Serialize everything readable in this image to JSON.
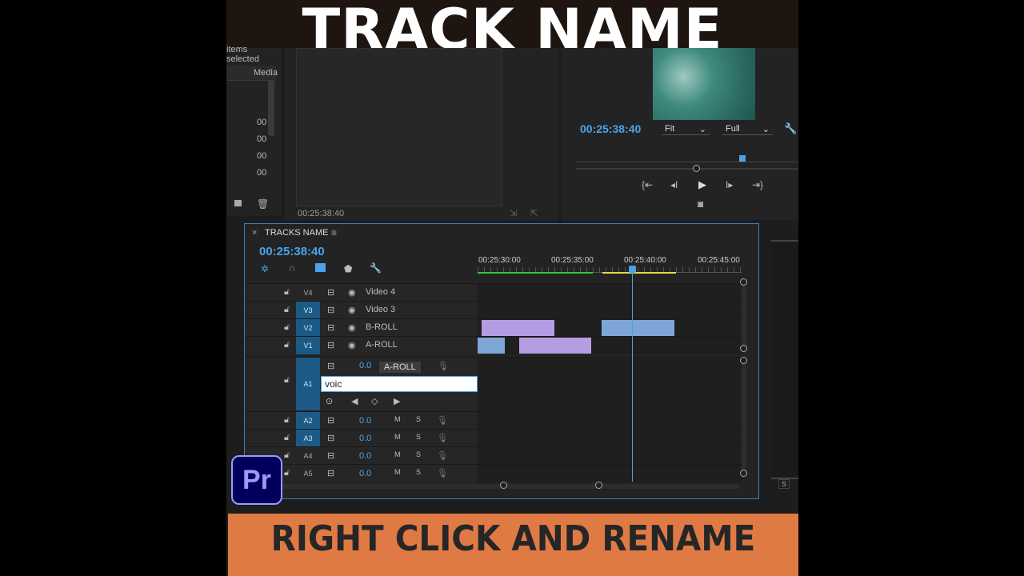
{
  "overlay": {
    "title": "TRACK NAME",
    "caption": "RIGHT CLICK AND RENAME",
    "logo_text": "Pr"
  },
  "project": {
    "selection_text": "items selected",
    "media_col": "Media",
    "rows": [
      "00",
      "00",
      "00",
      "00"
    ]
  },
  "source": {
    "timecode": "00:25:38:40"
  },
  "program": {
    "timecode": "00:25:38:40",
    "fit": "Fit",
    "quality": "Full"
  },
  "timeline": {
    "tab": "TRACKS NAME",
    "close": "×",
    "timecode": "00:25:38:40",
    "ruler": [
      "00:25:30:00",
      "00:25:35:00",
      "00:25:40:00",
      "00:25:45:00"
    ],
    "video_tracks": [
      {
        "tag": "V4",
        "name": "Video 4",
        "on": false
      },
      {
        "tag": "V3",
        "name": "Video 3",
        "on": true
      },
      {
        "tag": "V2",
        "name": "B-ROLL",
        "on": true
      },
      {
        "tag": "V1",
        "name": "A-ROLL",
        "on": true
      }
    ],
    "a1": {
      "tag": "A1",
      "volume": "0.0",
      "tooltip": "A-ROLL",
      "rename_value": "voic"
    },
    "audio_tracks": [
      {
        "tag": "A2",
        "volume": "0.0",
        "m": "M",
        "s": "S",
        "on": true
      },
      {
        "tag": "A3",
        "volume": "0.0",
        "m": "M",
        "s": "S",
        "on": true
      },
      {
        "tag": "A4",
        "volume": "0.0",
        "m": "M",
        "s": "S",
        "on": false
      },
      {
        "tag": "A5",
        "volume": "0.0",
        "m": "M",
        "s": "S",
        "on": false
      }
    ],
    "right_s": "S",
    "colors": {
      "purple_clip": "#b59ce3",
      "blue_clip": "#7ea6d6",
      "accent": "#4aa3ea",
      "caption_bg": "#e07a45"
    }
  }
}
